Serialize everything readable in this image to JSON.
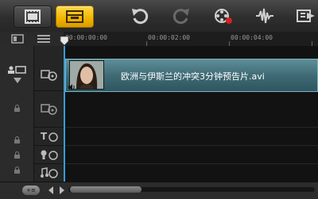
{
  "toolbar": {
    "buttons": [
      {
        "name": "storyboard-view-icon"
      },
      {
        "name": "timeline-view-icon"
      },
      {
        "name": "undo-icon"
      },
      {
        "name": "redo-icon"
      },
      {
        "name": "record-capture-icon"
      },
      {
        "name": "sound-mixer-icon"
      },
      {
        "name": "auto-music-icon"
      }
    ]
  },
  "ruler": {
    "timecodes": [
      "00:00:00:00",
      "00:00:02:00",
      "00:00:04:00"
    ],
    "track_manager_label": "+/−"
  },
  "tracks": [
    {
      "type": "video",
      "icon": "video-track-icon"
    },
    {
      "type": "overlay",
      "icon": "overlay-track-icon"
    },
    {
      "type": "title",
      "icon": "title-track-icon"
    },
    {
      "type": "voice",
      "icon": "voice-track-icon"
    },
    {
      "type": "music",
      "icon": "music-track-icon"
    }
  ],
  "clip": {
    "filename": "欧洲与伊斯兰的冲突3分钟预告片.avi"
  },
  "bottom": {
    "add_label": "+≡"
  },
  "colors": {
    "accent_active": "#f0b400",
    "clip_fill": "#3f6b75",
    "playhead": "#3a9ad9"
  }
}
